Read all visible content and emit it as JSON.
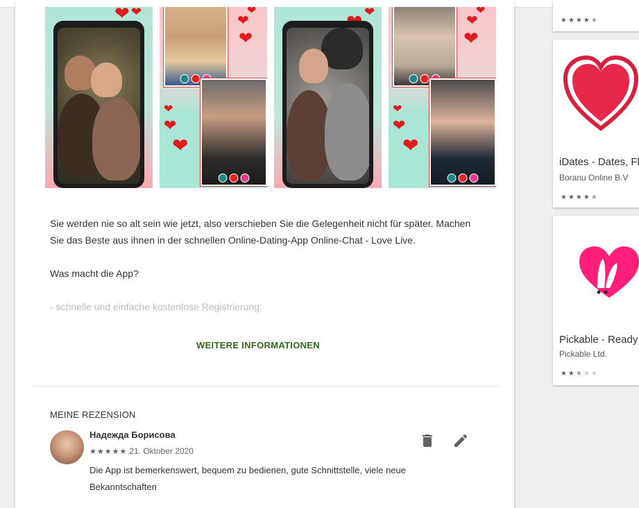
{
  "description": {
    "paragraph1": "Sie werden nie so alt sein wie jetzt, also verschieben Sie die Gelegenheit nicht für später. Machen Sie das Beste aus ihnen in der schnellen Online-Dating-App Online-Chat - Love Live.",
    "paragraph2": "Was macht die App?",
    "paragraph3": "- schnelle und einfache kostenlose Registrierung:",
    "more_label": "WEITERE INFORMATIONEN"
  },
  "review": {
    "section_title": "MEINE REZENSION",
    "author": "Надежда Борисова",
    "rating": 5,
    "date": "21. Oktober 2020",
    "text": "Die App ist bemerkenswert, bequem zu bedienen, gute Schnittstelle, viele neue Bekanntschaften",
    "delete_icon": "trash-icon",
    "edit_icon": "pencil-icon"
  },
  "similar_apps": [
    {
      "title": "",
      "developer": "",
      "rating": 4.5,
      "icon": "none"
    },
    {
      "title": "iDates - Dates, Fl",
      "developer": "Boranu Online B.V",
      "rating": 4.5,
      "icon": "red-heart-icon"
    },
    {
      "title": "Pickable - Ready",
      "developer": "Pickable Ltd.",
      "rating": 2.5,
      "icon": "pink-bunny-heart-icon"
    }
  ],
  "colors": {
    "accent_green": "#33691e",
    "heart_red": "#e01b1b",
    "pickable_pink": "#ff1f7a"
  }
}
